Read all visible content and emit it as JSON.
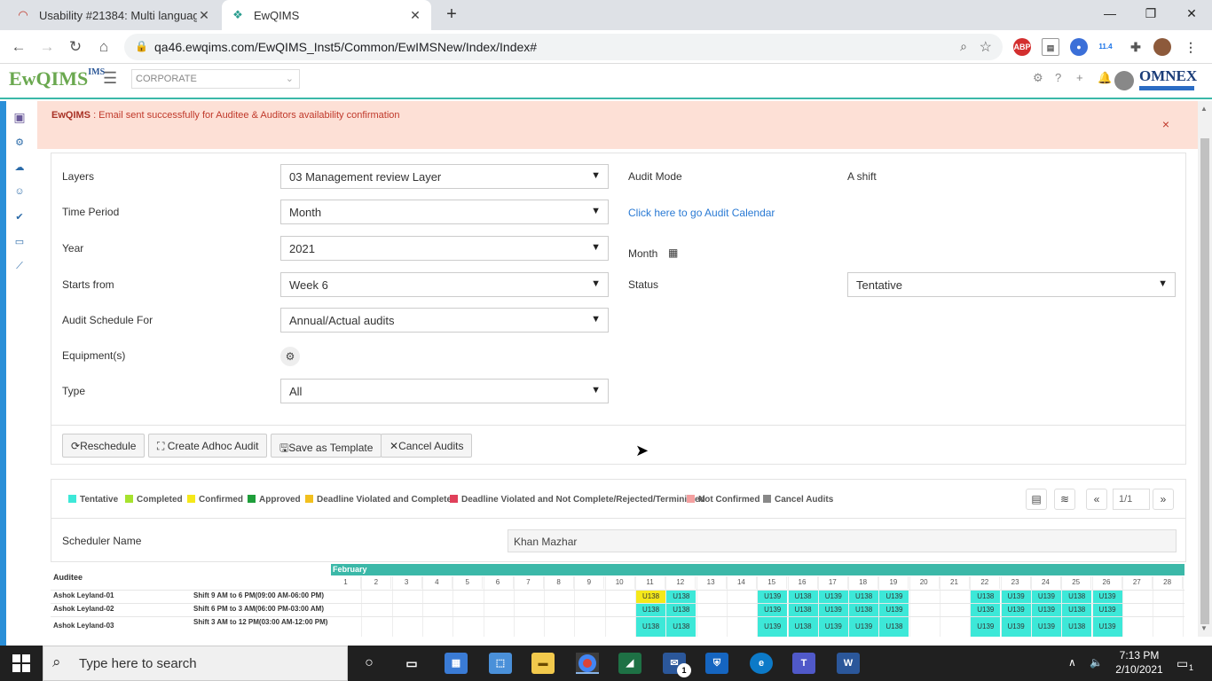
{
  "browser": {
    "tabs": [
      {
        "title": "Usability #21384: Multi language"
      },
      {
        "title": "EwQIMS"
      }
    ],
    "url": "qa46.ewqims.com/EwQIMS_Inst5/Common/EwIMSNew/Index/Index#",
    "ext_badge": "11.4"
  },
  "header": {
    "logo": "EwQIMS",
    "logo_sub": "IMS",
    "corporate": "CORPORATE",
    "brand": "OMNEX"
  },
  "alert": {
    "app": "EwQIMS",
    "message": " : Email sent successfully for Auditee & Auditors availability confirmation",
    "close": "×"
  },
  "form": {
    "layers_label": "Layers",
    "layers_value": "03 Management review Layer",
    "time_period_label": "Time Period",
    "time_period_value": "Month",
    "year_label": "Year",
    "year_value": "2021",
    "starts_from_label": "Starts from",
    "starts_from_value": "Week 6",
    "schedule_for_label": "Audit Schedule For",
    "schedule_for_value": "Annual/Actual audits",
    "equipment_label": "Equipment(s)",
    "type_label": "Type",
    "type_value": "All",
    "audit_mode_label": "Audit Mode",
    "audit_mode_value": "A shift",
    "calendar_link": "Click here to go Audit Calendar",
    "month_label": "Month",
    "status_label": "Status",
    "status_value": "Tentative"
  },
  "actions": {
    "reschedule": "Reschedule",
    "create_adhoc": "Create Adhoc Audit",
    "save_template": "Save as Template",
    "cancel_audits": "Cancel Audits"
  },
  "legend": [
    {
      "label": "Tentative",
      "color": "#3de8d8"
    },
    {
      "label": "Completed",
      "color": "#a6e22e"
    },
    {
      "label": "Confirmed",
      "color": "#f5e81a"
    },
    {
      "label": "Approved",
      "color": "#1e9e3a"
    },
    {
      "label": "Deadline Violated and Completed",
      "color": "#f2c01e"
    },
    {
      "label": "Deadline Violated and Not Complete/Rejected/Terminiated",
      "color": "#e0405a"
    },
    {
      "label": "Not Confirmed",
      "color": "#f4a0a0"
    },
    {
      "label": "Cancel Audits",
      "color": "#888888"
    }
  ],
  "pager": {
    "value": "1/1",
    "prev": "«",
    "next": "»"
  },
  "scheduler": {
    "label": "Scheduler Name",
    "value": "Khan Mazhar"
  },
  "calendar": {
    "auditee_header": "Auditee",
    "month": "February",
    "days": [
      "1",
      "2",
      "3",
      "4",
      "5",
      "6",
      "7",
      "8",
      "9",
      "10",
      "11",
      "12",
      "13",
      "14",
      "15",
      "16",
      "17",
      "18",
      "19",
      "20",
      "21",
      "22",
      "23",
      "24",
      "25",
      "26",
      "27",
      "28"
    ],
    "rows": [
      {
        "auditee": "Ashok Leyland-01",
        "shift": "Shift 9 AM to 6 PM(09:00 AM-06:00 PM)",
        "cells": {
          "11": "U138",
          "12": "U138",
          "15": "U139",
          "16": "U138",
          "17": "U139",
          "18": "U138",
          "19": "U139",
          "22": "U138",
          "23": "U139",
          "24": "U139",
          "25": "U138",
          "26": "U139"
        },
        "confirmed_day": "11"
      },
      {
        "auditee": "Ashok Leyland-02",
        "shift": "Shift 6 PM to 3 AM(06:00 PM-03:00 AM)",
        "cells": {
          "11": "U138",
          "12": "U138",
          "15": "U139",
          "16": "U138",
          "17": "U139",
          "18": "U138",
          "19": "U139",
          "22": "U139",
          "23": "U139",
          "24": "U139",
          "25": "U138",
          "26": "U139"
        }
      },
      {
        "auditee": "Ashok Leyland-03",
        "shift": "Shift 3 AM to 12 PM(03:00 AM-12:00 PM)",
        "cells": {
          "11": "U138",
          "12": "U138",
          "15": "U139",
          "16": "U138",
          "17": "U139",
          "18": "U139",
          "19": "U138",
          "22": "U139",
          "23": "U139",
          "24": "U139",
          "25": "U138",
          "26": "U139"
        }
      }
    ]
  },
  "taskbar": {
    "search_placeholder": "Type here to search",
    "time": "7:13 PM",
    "date": "2/10/2021",
    "notif_count": "1",
    "mail_count": "1"
  }
}
